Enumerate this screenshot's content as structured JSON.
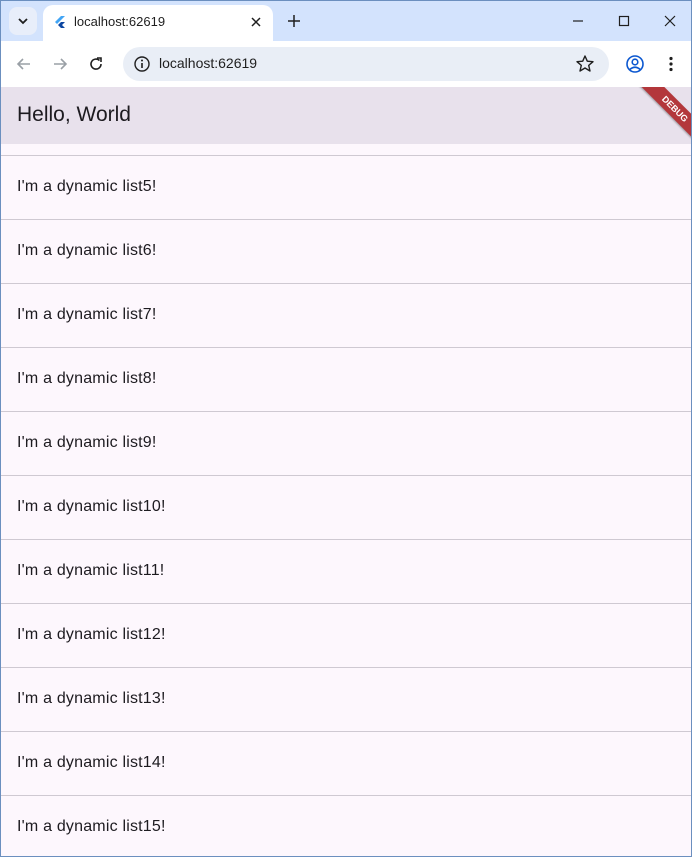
{
  "browser": {
    "tab_title": "localhost:62619",
    "url": "localhost:62619"
  },
  "app": {
    "title": "Hello, World",
    "debug_label": "DEBUG",
    "items": [
      "I'm a dynamic list5!",
      "I'm a dynamic list6!",
      "I'm a dynamic list7!",
      "I'm a dynamic list8!",
      "I'm a dynamic list9!",
      "I'm a dynamic list10!",
      "I'm a dynamic list11!",
      "I'm a dynamic list12!",
      "I'm a dynamic list13!",
      "I'm a dynamic list14!",
      "I'm a dynamic list15!"
    ]
  },
  "colors": {
    "appbar": "#e8e1ec",
    "list_background": "#fdf7fd",
    "debug_banner": "#b3373b",
    "tabstrip": "#d3e3fd"
  }
}
